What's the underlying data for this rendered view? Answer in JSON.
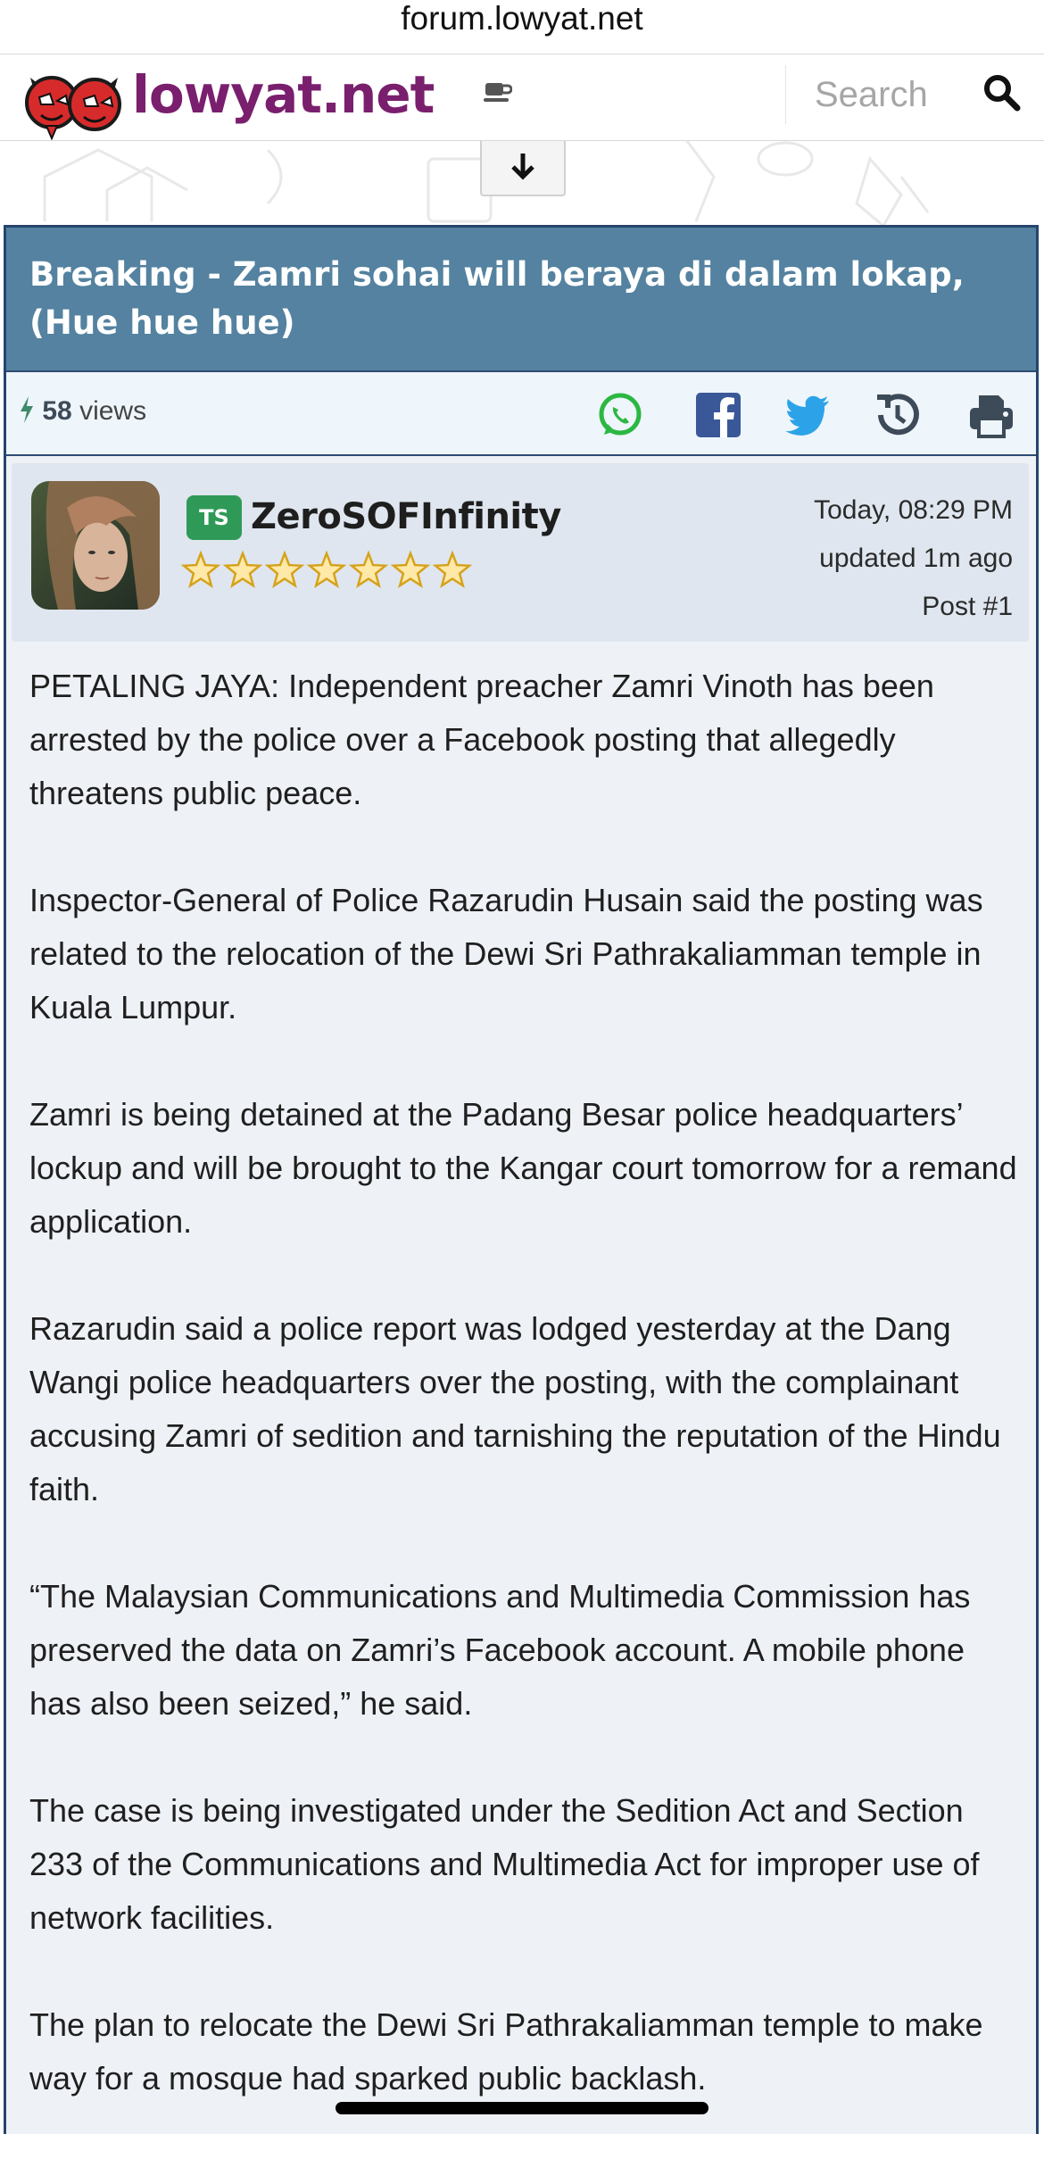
{
  "browser": {
    "url": "forum.lowyat.net"
  },
  "header": {
    "logo_text": "lowyat.net",
    "search_placeholder": "Search"
  },
  "topic": {
    "title": "Breaking - Zamri sohai will beraya di dalam lokap, (Hue hue hue)",
    "views_count": "58",
    "views_label": "views",
    "share_icons": [
      "whatsapp-icon",
      "facebook-icon",
      "twitter-icon",
      "history-icon",
      "print-icon"
    ]
  },
  "post": {
    "badge": "TS",
    "username": "ZeroSOFInfinity",
    "rank_stars": 7,
    "date": "Today, 08:29 PM",
    "updated": "updated 1m ago",
    "post_number": "Post #1",
    "paragraphs": [
      "PETALING JAYA: Independent preacher Zamri Vinoth has been arrested by the police over a Facebook posting that allegedly threatens public peace.",
      "Inspector-General of Police Razarudin Husain said the posting was related to the relocation of the Dewi Sri Pathrakaliamman temple in Kuala Lumpur.",
      "Zamri is being detained at the Padang Besar police headquarters’ lockup and will be brought to the Kangar court tomorrow for a remand application.",
      "Razarudin said a police report was lodged yesterday at the Dang Wangi police headquarters over the posting, with the complainant accusing Zamri of sedition and tarnishing the reputation of the Hindu faith.",
      "“The Malaysian Communications and Multimedia Commission has preserved the data on Zamri’s Facebook account. A mobile phone has also been seized,” he said.",
      "The case is being investigated under the Sedition Act and Section 233 of the Communications and Multimedia Act for improper use of network facilities.",
      "The plan to relocate the Dewi Sri Pathrakaliamman temple to make way for a mosque had sparked public backlash."
    ]
  },
  "colors": {
    "title_bar": "#5482a0",
    "border": "#26456e",
    "logo": "#7a1f6e",
    "badge": "#2f9a57"
  }
}
